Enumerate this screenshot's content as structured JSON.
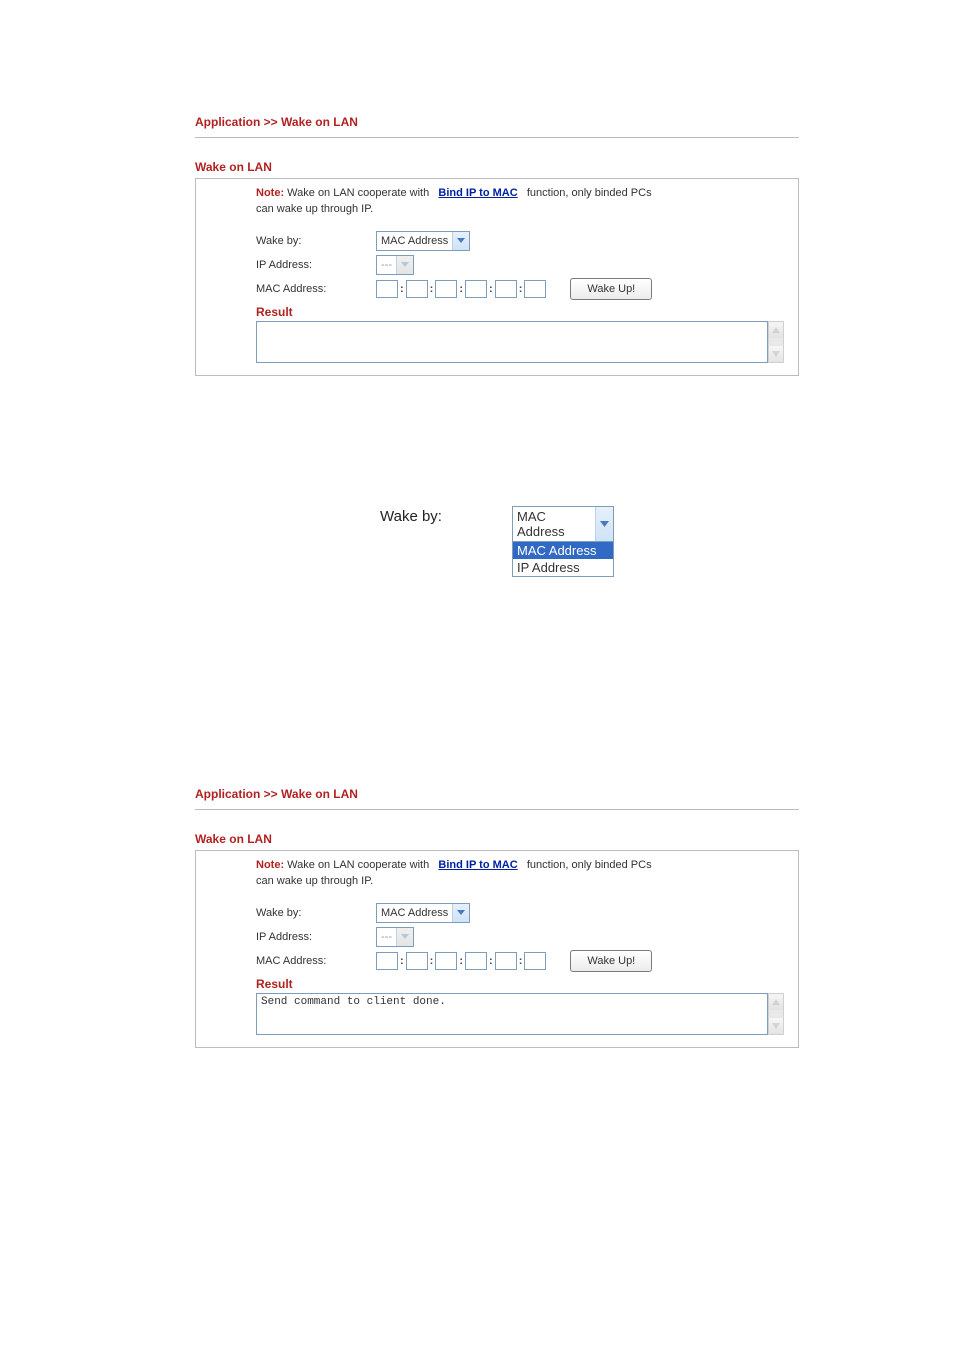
{
  "breadcrumb": "Application >> Wake on LAN",
  "section_title": "Wake on LAN",
  "note": {
    "label": "Note:",
    "seg1": "Wake on LAN cooperate with",
    "link": "Bind IP to MAC",
    "seg2": "function,  only binded PCs",
    "seg3": "can wake up through IP."
  },
  "form": {
    "wake_by_label": "Wake by:",
    "ip_label": "IP Address:",
    "mac_label": "MAC Address:",
    "wake_by_value": "MAC Address",
    "ip_value": "---",
    "mac_sep": ":",
    "wake_btn": "Wake Up!"
  },
  "result_title": "Result",
  "result_text_panel1": "",
  "result_text_panel2": "Send command to client done.",
  "zoom": {
    "label": "Wake by:",
    "head": "MAC Address",
    "opt1": "MAC Address",
    "opt2": "IP Address"
  }
}
